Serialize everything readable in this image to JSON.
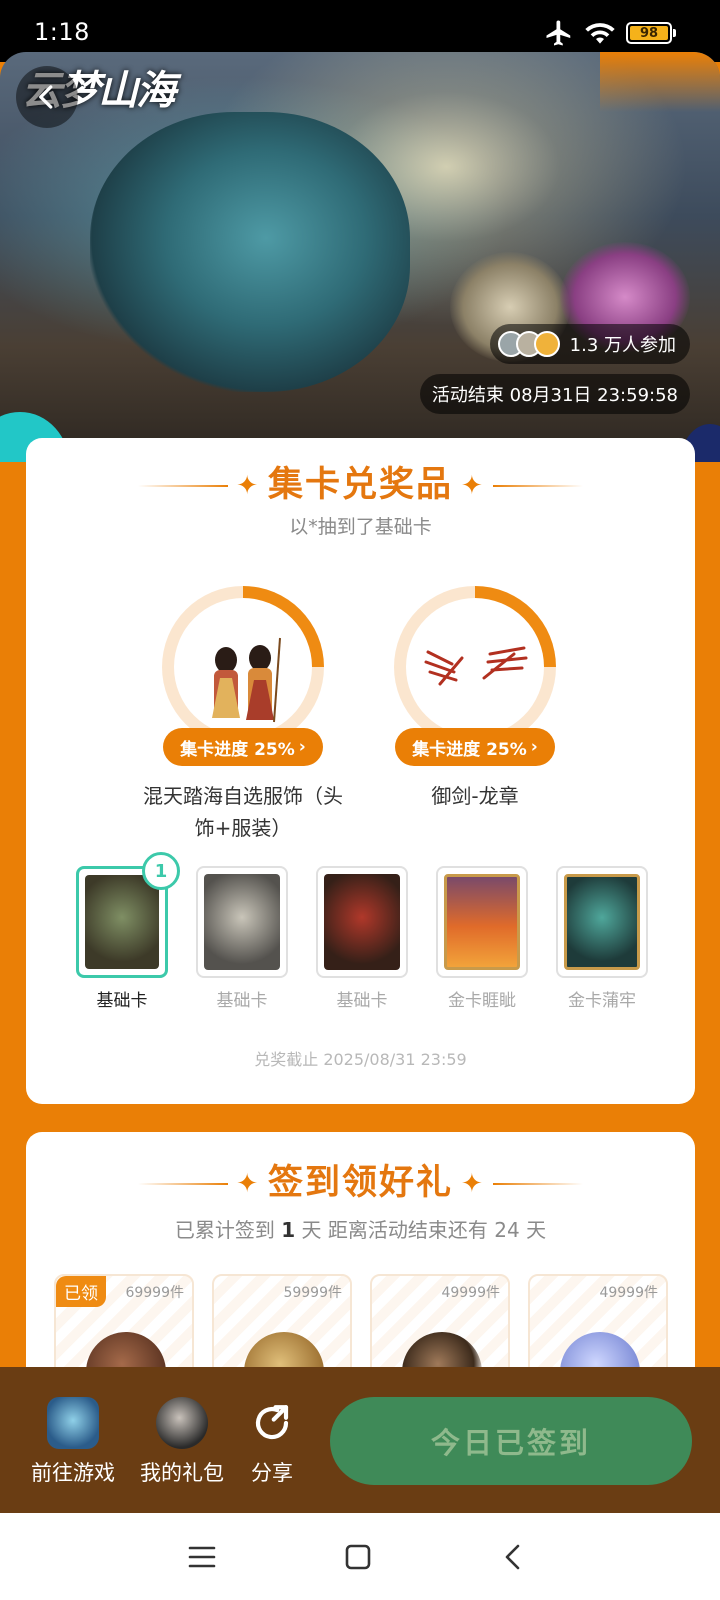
{
  "status_bar": {
    "time": "1:18",
    "battery": "98"
  },
  "hero": {
    "logo_text": "云梦山海",
    "participants": "1.3 万人参加",
    "end_time": "活动结束 08月31日 23:59:58"
  },
  "collect": {
    "title": "集卡兑奖品",
    "subtitle": "以*抽到了基础卡",
    "prizes": [
      {
        "progress_label": "集卡进度 25%",
        "progress": 0.25,
        "name": "混天踏海自选服饰（头饰+服装）"
      },
      {
        "progress_label": "集卡进度 25%",
        "progress": 0.25,
        "name": "御剑-龙章"
      }
    ],
    "cards": [
      {
        "label": "基础卡",
        "count": "1"
      },
      {
        "label": "基础卡"
      },
      {
        "label": "基础卡"
      },
      {
        "label": "金卡睚眦"
      },
      {
        "label": "金卡蒲牢"
      }
    ],
    "deadline": "兑奖截止 2025/08/31 23:59"
  },
  "signin": {
    "title": "签到领好礼",
    "subtitle_prefix": "已累计签到 ",
    "days": "1",
    "subtitle_suffix": " 天  距离活动结束还有 24 天",
    "items": [
      {
        "qty": "69999件",
        "claimed": "已领"
      },
      {
        "qty": "59999件"
      },
      {
        "qty": "49999件"
      },
      {
        "qty": "49999件"
      }
    ]
  },
  "bottom_bar": {
    "go_game": "前往游戏",
    "my_gifts": "我的礼包",
    "share": "分享",
    "signed_button": "今日已签到"
  }
}
